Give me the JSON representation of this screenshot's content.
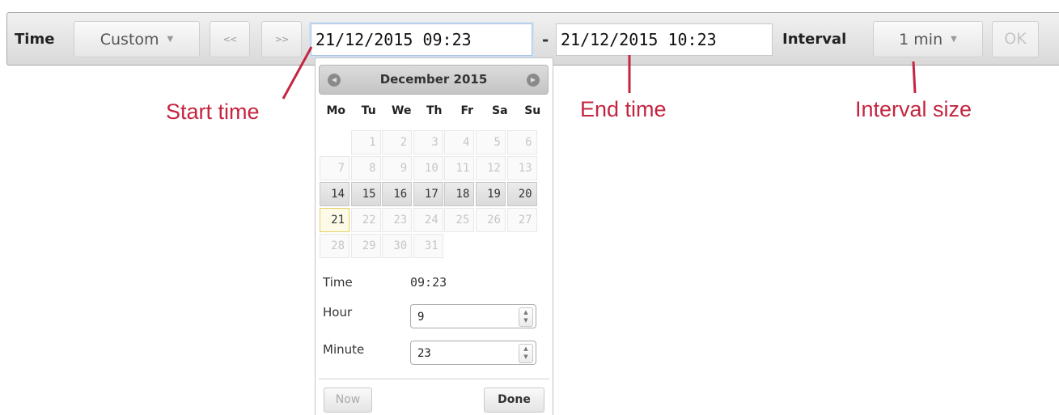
{
  "toolbar": {
    "time_label": "Time",
    "preset_value": "Custom",
    "prev_label": "<<",
    "next_label": ">>",
    "start_value": "21/12/2015 09:23",
    "separator": "-",
    "end_value": "21/12/2015 10:23",
    "interval_label": "Interval",
    "interval_value": "1 min",
    "ok_label": "OK"
  },
  "annotations": {
    "start": "Start time",
    "end": "End time",
    "interval": "Interval size"
  },
  "datepicker": {
    "month_title": "December 2015",
    "day_names": [
      "Mo",
      "Tu",
      "We",
      "Th",
      "Fr",
      "Sa",
      "Su"
    ],
    "days": [
      {
        "d": "",
        "s": "empty"
      },
      {
        "d": "1",
        "s": "off"
      },
      {
        "d": "2",
        "s": "off"
      },
      {
        "d": "3",
        "s": "off"
      },
      {
        "d": "4",
        "s": "off"
      },
      {
        "d": "5",
        "s": "off"
      },
      {
        "d": "6",
        "s": "off"
      },
      {
        "d": "7",
        "s": "off"
      },
      {
        "d": "8",
        "s": "off"
      },
      {
        "d": "9",
        "s": "off"
      },
      {
        "d": "10",
        "s": "off"
      },
      {
        "d": "11",
        "s": "off"
      },
      {
        "d": "12",
        "s": "off"
      },
      {
        "d": "13",
        "s": "off"
      },
      {
        "d": "14",
        "s": "active"
      },
      {
        "d": "15",
        "s": "active"
      },
      {
        "d": "16",
        "s": "active"
      },
      {
        "d": "17",
        "s": "active"
      },
      {
        "d": "18",
        "s": "active"
      },
      {
        "d": "19",
        "s": "active"
      },
      {
        "d": "20",
        "s": "active"
      },
      {
        "d": "21",
        "s": "today"
      },
      {
        "d": "22",
        "s": "off"
      },
      {
        "d": "23",
        "s": "off"
      },
      {
        "d": "24",
        "s": "off"
      },
      {
        "d": "25",
        "s": "off"
      },
      {
        "d": "26",
        "s": "off"
      },
      {
        "d": "27",
        "s": "off"
      },
      {
        "d": "28",
        "s": "off"
      },
      {
        "d": "29",
        "s": "off"
      },
      {
        "d": "30",
        "s": "off"
      },
      {
        "d": "31",
        "s": "off"
      }
    ],
    "time_label": "Time",
    "time_value": "09:23",
    "hour_label": "Hour",
    "hour_value": "9",
    "minute_label": "Minute",
    "minute_value": "23",
    "now_label": "Now",
    "done_label": "Done"
  },
  "colors": {
    "annotation": "#c42540",
    "today_highlight": "#e6cf6a"
  },
  "icons": {
    "prev_month": "circle-left-arrow-icon",
    "next_month": "circle-right-arrow-icon",
    "dropdown": "caret-down-icon",
    "spinner": "spin-arrows-icon"
  }
}
